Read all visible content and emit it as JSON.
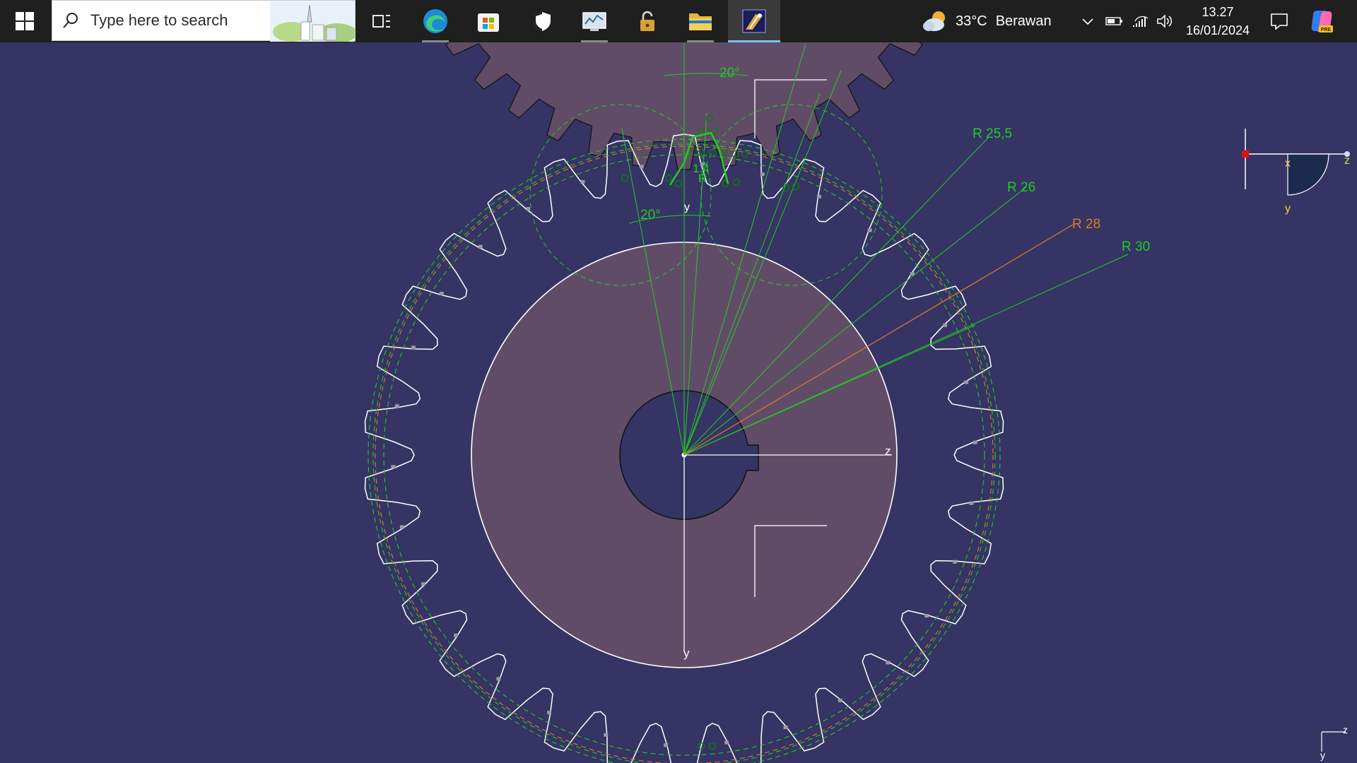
{
  "taskbar": {
    "search": {
      "placeholder": "Type here to search"
    },
    "apps": [
      {
        "name": "Task View"
      },
      {
        "name": "Microsoft Edge"
      },
      {
        "name": "Microsoft Store"
      },
      {
        "name": "Windows Security"
      },
      {
        "name": "Resource Monitor"
      },
      {
        "name": "Lock"
      },
      {
        "name": "File Explorer"
      },
      {
        "name": "CATIA V5"
      }
    ],
    "weather": {
      "temp": "33°C",
      "condition": "Berawan"
    },
    "clock": {
      "time": "13.27",
      "date": "16/01/2024"
    }
  },
  "cad": {
    "dimensions": {
      "angle_top": "20°",
      "angle_mid": "20°",
      "small_value": "1.4",
      "r_small": "R",
      "r1": "R 25,5",
      "r2": "R 26",
      "r3": "R 28",
      "r4": "R 30"
    },
    "axes": {
      "main_z": "z",
      "main_y": "y",
      "small_y": "y",
      "compass_x": "x",
      "compass_y": "y",
      "compass_z": "z",
      "corner_z": "z",
      "corner_y": "y"
    },
    "colors": {
      "background": "#353464",
      "gear_fill": "#614c68",
      "profile": "#ffffff",
      "construction": "#22cc22",
      "pitch_circle": "#e07a2a"
    }
  }
}
